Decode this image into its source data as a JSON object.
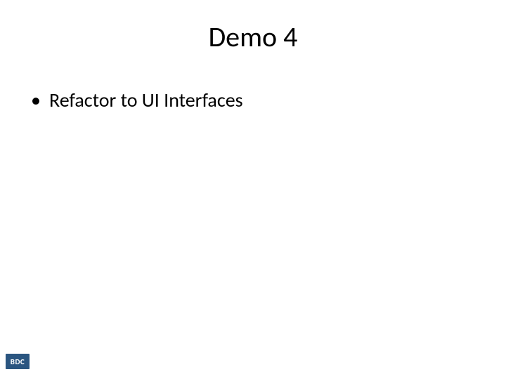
{
  "slide": {
    "title": "Demo 4",
    "bullets": [
      "Refactor to UI Interfaces"
    ],
    "logo_text": "BDC"
  }
}
